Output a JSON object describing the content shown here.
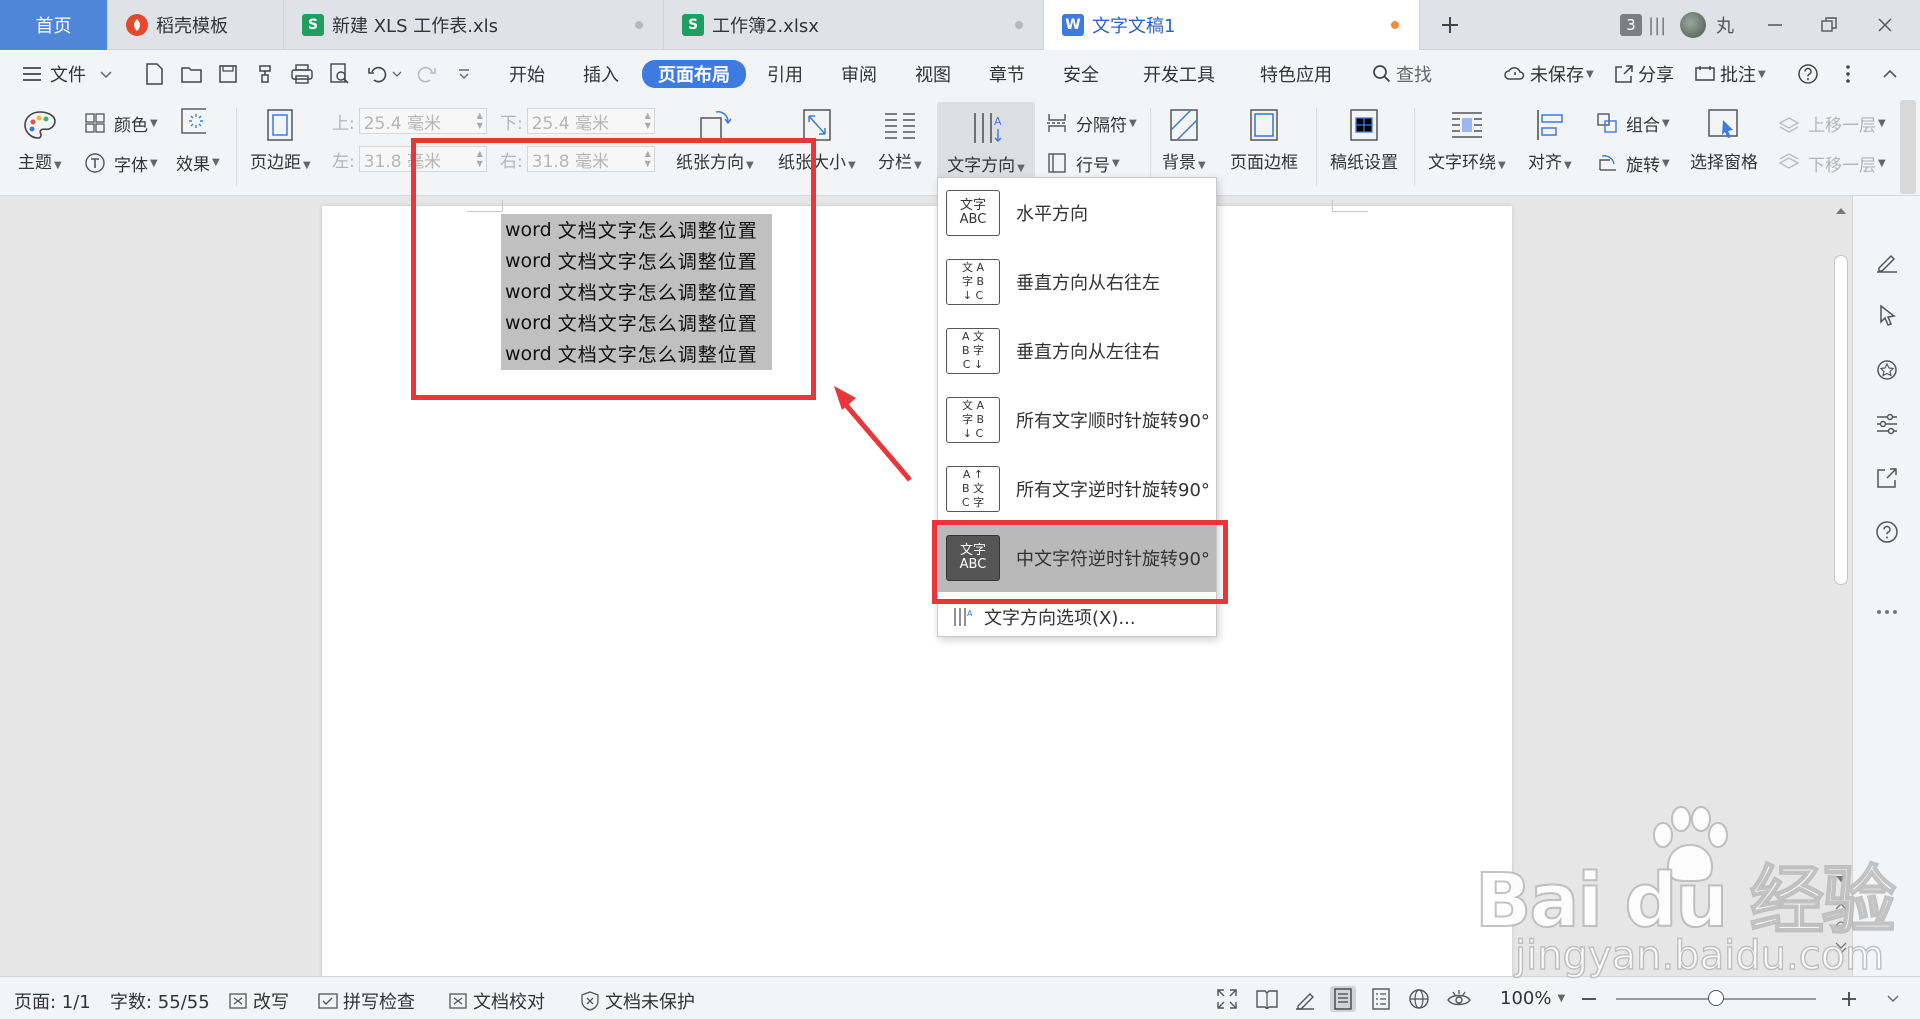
{
  "tabs": [
    {
      "label": "首页",
      "type": "home"
    },
    {
      "label": "稻壳模板",
      "icon": "docer-icon",
      "icon_color": "#e8472b"
    },
    {
      "label": "新建 XLS 工作表.xls",
      "icon": "sheet-icon",
      "icon_color": "#1f9f5f"
    },
    {
      "label": "工作簿2.xlsx",
      "icon": "sheet-icon",
      "icon_color": "#1f9f5f"
    },
    {
      "label": "文字文稿1",
      "icon": "writer-icon",
      "icon_color": "#3d7be0",
      "active": true
    }
  ],
  "tab_icons": {
    "sheet": "S",
    "writer": "W"
  },
  "tabbar_right": {
    "window_count": "3",
    "user_name": "丸"
  },
  "menu": {
    "file": "文件",
    "items": [
      "开始",
      "插入",
      "页面布局",
      "引用",
      "审阅",
      "视图",
      "章节",
      "安全",
      "开发工具",
      "特色应用"
    ],
    "active": "页面布局",
    "search": "查找",
    "unsaved": "未保存",
    "share": "分享",
    "comment": "批注"
  },
  "ribbon": {
    "theme": "主题",
    "color": "颜色",
    "font": "字体",
    "effect": "效果",
    "margins": "页边距",
    "top_label": "上:",
    "bottom_label": "下:",
    "left_label": "左:",
    "right_label": "右:",
    "top_value": "25.4 毫米",
    "bottom_value": "25.4 毫米",
    "left_value": "31.8 毫米",
    "right_value": "31.8 毫米",
    "orientation": "纸张方向",
    "size": "纸张大小",
    "columns": "分栏",
    "text_direction": "文字方向",
    "breaks": "分隔符",
    "line_numbers": "行号",
    "background": "背景",
    "page_border": "页面边框",
    "manuscript": "稿纸设置",
    "wrap": "文字环绕",
    "align": "对齐",
    "group": "组合",
    "rotate": "旋转",
    "selection_pane": "选择窗格",
    "bring_forward": "上移一层",
    "send_backward": "下移一层"
  },
  "document": {
    "lines": [
      {
        "en": "word",
        "cn": "文档文字怎么调整位置"
      },
      {
        "en": "word",
        "cn": "文档文字怎么调整位置"
      },
      {
        "en": "word",
        "cn": "文档文字怎么调整位置"
      },
      {
        "en": "word",
        "cn": "文档文字怎么调整位置"
      },
      {
        "en": "word",
        "cn": "文档文字怎么调整位置"
      }
    ]
  },
  "dropdown": {
    "items": [
      {
        "label": "水平方向",
        "icon_text": "文字ABC"
      },
      {
        "label": "垂直方向从右往左",
        "icon_text": "ABC文字"
      },
      {
        "label": "垂直方向从左往右",
        "icon_text": "文字ABC"
      },
      {
        "label": "所有文字顺时针旋转90°",
        "icon_text": "ABC文字"
      },
      {
        "label": "所有文字逆时针旋转90°",
        "icon_text": "ABC文字"
      },
      {
        "label": "中文字符逆时针旋转90°",
        "icon_text": "文字ABC",
        "selected": true
      }
    ],
    "options": "文字方向选项(X)..."
  },
  "status": {
    "page": "页面: 1/1",
    "words": "字数: 55/55",
    "overtype": "改写",
    "spell": "拼写检查",
    "proof": "文档校对",
    "protect": "文档未保护",
    "zoom": "100%",
    "zoom_fraction": 0.5
  },
  "watermark": {
    "brand": "Bai du 经验",
    "url": "jingyan.baidu.com"
  },
  "colors": {
    "accent": "#3d7be0",
    "highlight": "#e8363b",
    "selection": "#c0c0c0"
  }
}
